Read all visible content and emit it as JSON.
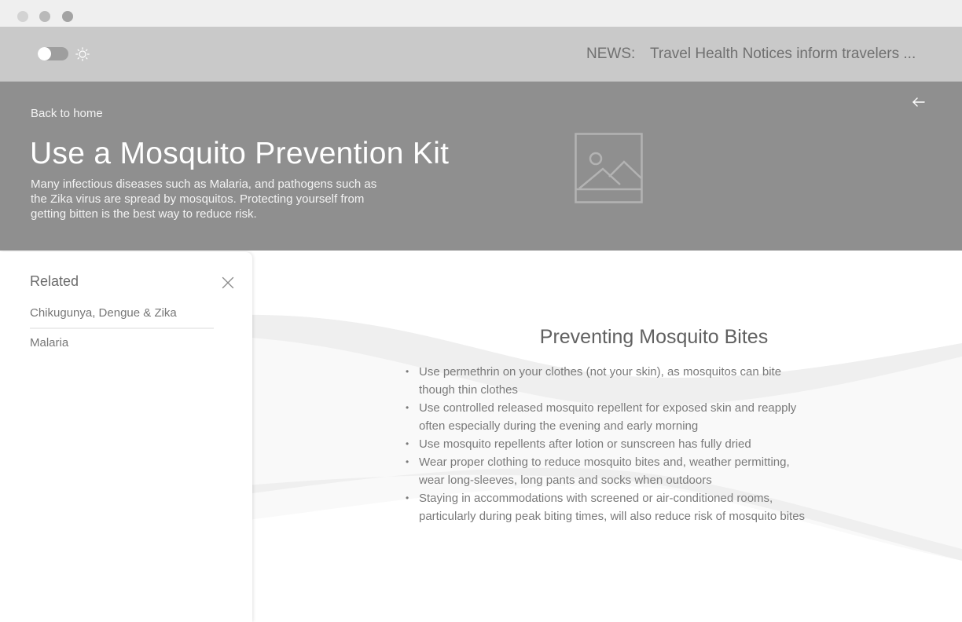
{
  "window": {
    "controls": [
      "close",
      "minimize",
      "maximize"
    ]
  },
  "topbar": {
    "theme_toggle": {
      "state": "off",
      "icon": "sun-icon"
    },
    "news_label": "NEWS:",
    "news_text": "Travel Health Notices inform travelers ..."
  },
  "hero": {
    "back_link": "Back to home",
    "title": "Use a Mosquito Prevention Kit",
    "description": "Many infectious diseases such as Malaria, and pathogens such as the Zika virus are spread by mosquitos.  Protecting yourself from getting bitten is the best way to reduce risk.",
    "image_icon": "image-placeholder-icon",
    "back_arrow_icon": "arrow-left-icon"
  },
  "related": {
    "title": "Related",
    "close_icon": "close-icon",
    "items": [
      {
        "label": "Chikugunya, Dengue & Zika"
      },
      {
        "label": "Malaria"
      }
    ]
  },
  "content": {
    "title": "Preventing Mosquito Bites",
    "bullet_glyph": "•",
    "bullets": [
      "Use permethrin on your clothes (not your skin), as mosquitos can bite though thin clothes",
      "Use controlled released mosquito repellent for exposed skin and reapply often especially during the evening and early morning",
      "Use mosquito repellents after lotion or sunscreen has fully dried",
      "Wear proper clothing to reduce mosquito bites and, weather permitting, wear long-sleeves, long pants and socks when outdoors",
      "Staying in accommodations with screened or air-conditioned rooms, particularly during peak biting times, will also reduce risk of mosquito bites"
    ]
  },
  "colors": {
    "titlebar": "#efefef",
    "topbar": "#c9c9c9",
    "hero": "#8f8f8f",
    "text_muted": "#7a7a7a"
  }
}
